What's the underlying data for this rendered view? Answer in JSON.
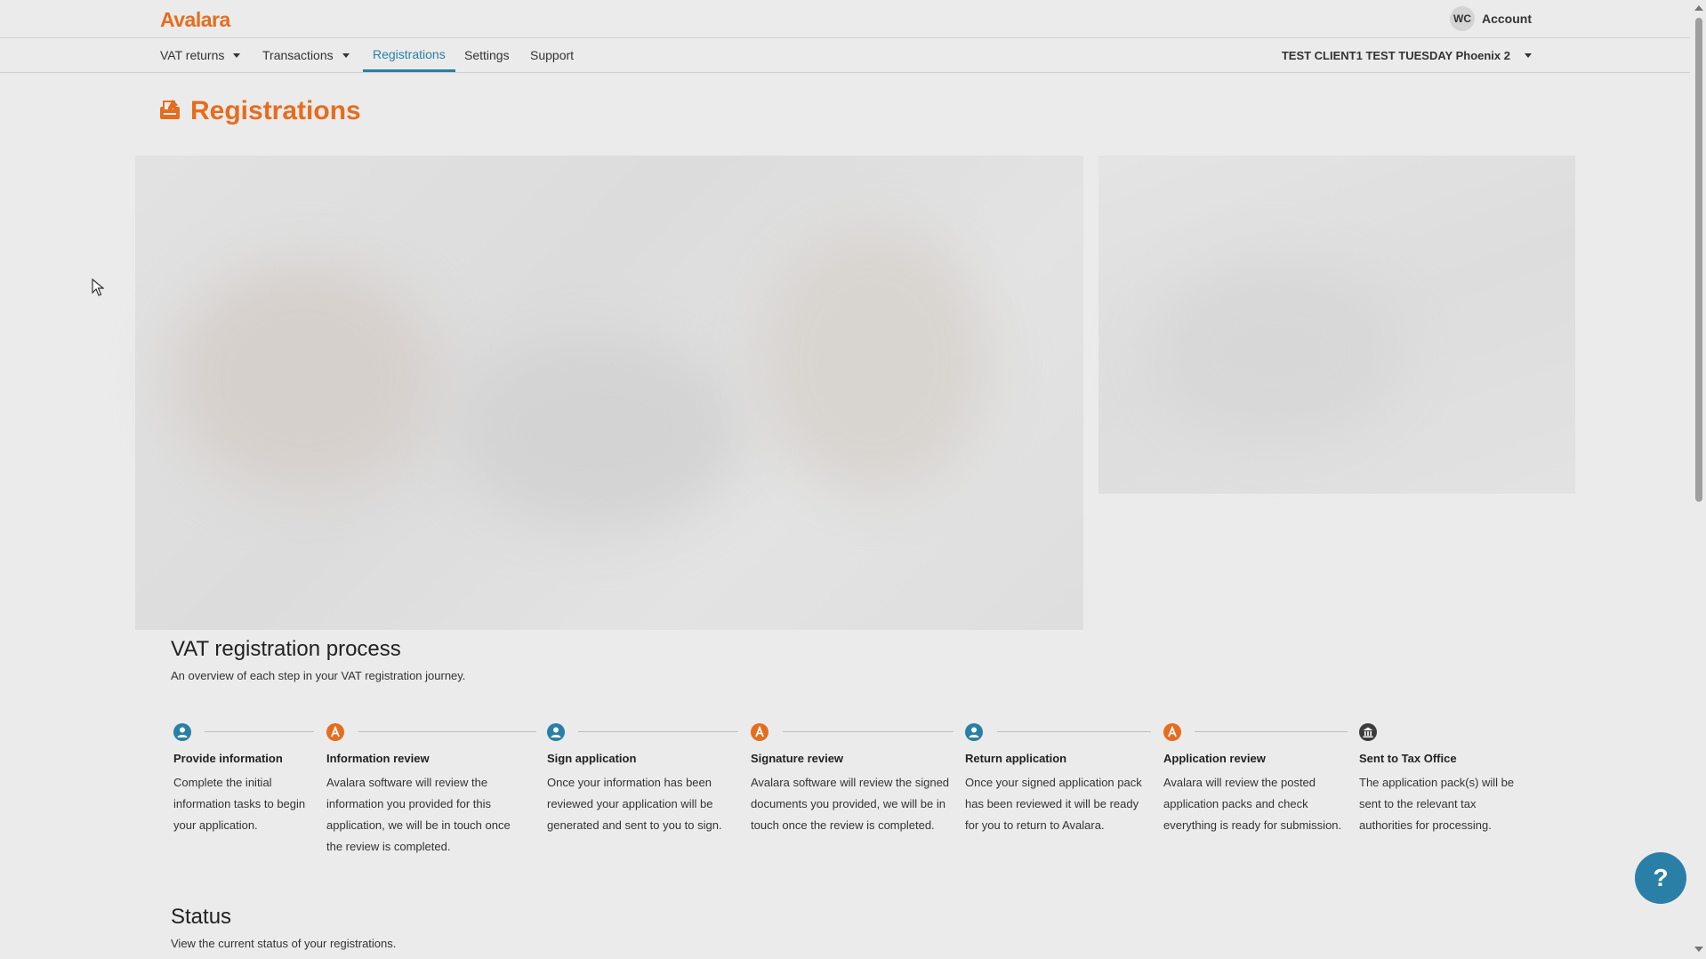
{
  "header": {
    "logo_text": "Avalara",
    "account": {
      "initials": "WC",
      "label": "Account"
    }
  },
  "nav": {
    "items": [
      {
        "label": "VAT returns",
        "dropdown": true
      },
      {
        "label": "Transactions",
        "dropdown": true
      },
      {
        "label": "Registrations",
        "active": true
      },
      {
        "label": "Settings"
      },
      {
        "label": "Support"
      }
    ],
    "client_selector": "TEST CLIENT1 TEST TUESDAY Phoenix 2"
  },
  "page": {
    "title": "Registrations",
    "title_icon": "registration-icon"
  },
  "process": {
    "title": "VAT registration process",
    "subtitle": "An overview of each step in your VAT registration journey.",
    "steps": [
      {
        "icon": "person-icon",
        "title": "Provide information",
        "desc": "Complete the initial information tasks to begin your application."
      },
      {
        "icon": "avalara-icon",
        "title": "Information review",
        "desc": "Avalara software will review the information you provided for this application, we will be in touch once the review is completed."
      },
      {
        "icon": "person-icon",
        "title": "Sign application",
        "desc": "Once your information has been reviewed your application will be generated and sent to you to sign."
      },
      {
        "icon": "avalara-icon",
        "title": "Signature review",
        "desc": "Avalara software will review the signed documents you provided, we will be in touch once the review is completed."
      },
      {
        "icon": "person-icon",
        "title": "Return application",
        "desc": "Once your signed application pack has been reviewed it will be ready for you to return to Avalara."
      },
      {
        "icon": "avalara-icon",
        "title": "Application review",
        "desc": "Avalara will review the posted application packs and check everything is ready for submission."
      },
      {
        "icon": "tax-office-icon",
        "title": "Sent to Tax Office",
        "desc": "The application pack(s) will be sent to the relevant tax authorities for processing."
      }
    ]
  },
  "status": {
    "title": "Status",
    "subtitle": "View the current status of your registrations."
  },
  "help_button": "?",
  "colors": {
    "brand_orange": "#e56d1f",
    "accent_blue": "#2a7fa6"
  }
}
